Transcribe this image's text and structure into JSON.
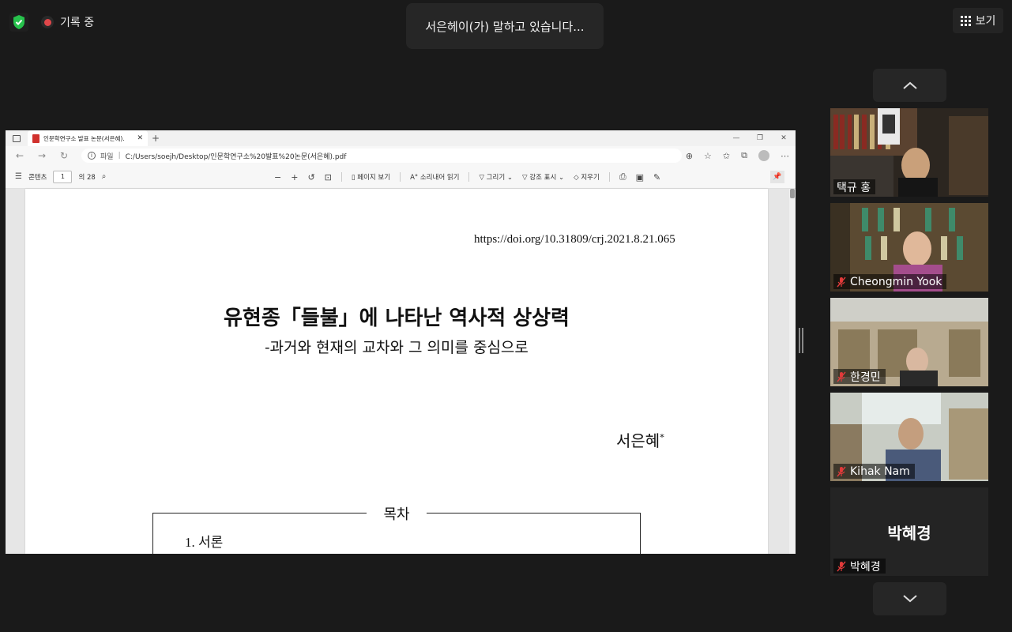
{
  "top_bar": {
    "recording_label": "기록 중",
    "speaking_banner": "서은헤이(가) 말하고 있습니다...",
    "view_label": "보기"
  },
  "browser": {
    "tab_title": "인문학연구소 발표 논문(서은혜).",
    "address_label": "파일",
    "address_url": "C:/Users/soejh/Desktop/인문학연구소%20발표%20논문(서은혜).pdf"
  },
  "pdf_toolbar": {
    "contents_label": "콘텐츠",
    "page_number": "1",
    "page_total": "의 28",
    "page_view_label": "페이지 보기",
    "read_aloud_label": "소리내어 읽기",
    "draw_label": "그리기",
    "highlight_label": "강조 표시",
    "erase_label": "지우기"
  },
  "document": {
    "doi": "https://doi.org/10.31809/crj.2021.8.21.065",
    "title": "유현종「들불」에 나타난 역사적 상상력",
    "subtitle": "-과거와 현재의 교차와 그 의미를 중심으로",
    "author": "서은혜",
    "author_mark": "*",
    "toc_title": "목차",
    "toc_first_item": "1. 서론"
  },
  "participants": [
    {
      "name": "택규 홍",
      "muted": false
    },
    {
      "name": "Cheongmin Yook",
      "muted": true
    },
    {
      "name": "한경민",
      "muted": true
    },
    {
      "name": "Kihak Nam",
      "muted": true
    },
    {
      "name": "박혜경",
      "muted": true,
      "display_name": "박혜경"
    }
  ],
  "colors": {
    "background": "#1a1a1a",
    "shield_green": "#27c24c",
    "record_red": "#e0474a",
    "mute_red": "#e03a3a"
  }
}
